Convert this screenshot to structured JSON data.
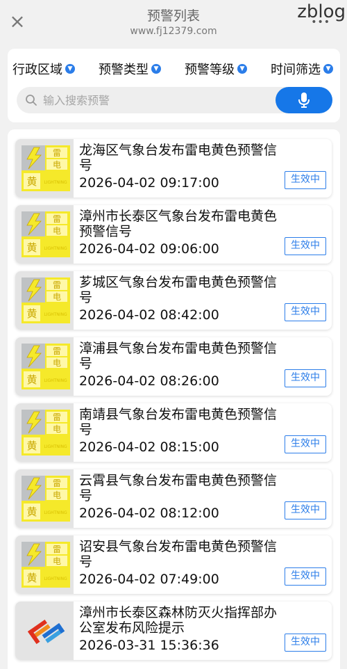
{
  "header": {
    "title": "预警列表",
    "url": "www.fj12379.com",
    "close_glyph": "×",
    "more_glyph": "•••",
    "watermark": "zblog"
  },
  "filters": [
    {
      "label": "行政区域"
    },
    {
      "label": "预警类型"
    },
    {
      "label": "预警等级"
    },
    {
      "label": "时间筛选"
    }
  ],
  "search": {
    "placeholder": "输入搜索预警",
    "icon": "search-icon",
    "button_icon": "microphone-icon"
  },
  "colors": {
    "accent": "#1677e8",
    "lightning_yellow": "#f5e92a"
  },
  "alerts": [
    {
      "title": "龙海区气象台发布雷电黄色预警信号",
      "time": "2026-04-02 09:17:00",
      "status": "生效中",
      "icon": "lightning-yellow-icon"
    },
    {
      "title": "漳州市长泰区气象台发布雷电黄色预警信号",
      "time": "2026-04-02 09:06:00",
      "status": "生效中",
      "icon": "lightning-yellow-icon"
    },
    {
      "title": "芗城区气象台发布雷电黄色预警信号",
      "time": "2026-04-02 08:42:00",
      "status": "生效中",
      "icon": "lightning-yellow-icon"
    },
    {
      "title": "漳浦县气象台发布雷电黄色预警信号",
      "time": "2026-04-02 08:26:00",
      "status": "生效中",
      "icon": "lightning-yellow-icon"
    },
    {
      "title": "南靖县气象台发布雷电黄色预警信号",
      "time": "2026-04-02 08:15:00",
      "status": "生效中",
      "icon": "lightning-yellow-icon"
    },
    {
      "title": "云霄县气象台发布雷电黄色预警信号",
      "time": "2026-04-02 08:12:00",
      "status": "生效中",
      "icon": "lightning-yellow-icon"
    },
    {
      "title": "诏安县气象台发布雷电黄色预警信号",
      "time": "2026-04-02 07:49:00",
      "status": "生效中",
      "icon": "lightning-yellow-icon"
    },
    {
      "title": "漳州市长泰区森林防灭火指挥部办公室发布风险提示",
      "time": "2026-03-31 15:36:36",
      "status": "生效中",
      "icon": "forest-fire-logo-icon"
    }
  ],
  "lightning_icon_text": {
    "char1": "雷",
    "char2": "电",
    "level": "黄",
    "en": "LIGHTNING"
  }
}
